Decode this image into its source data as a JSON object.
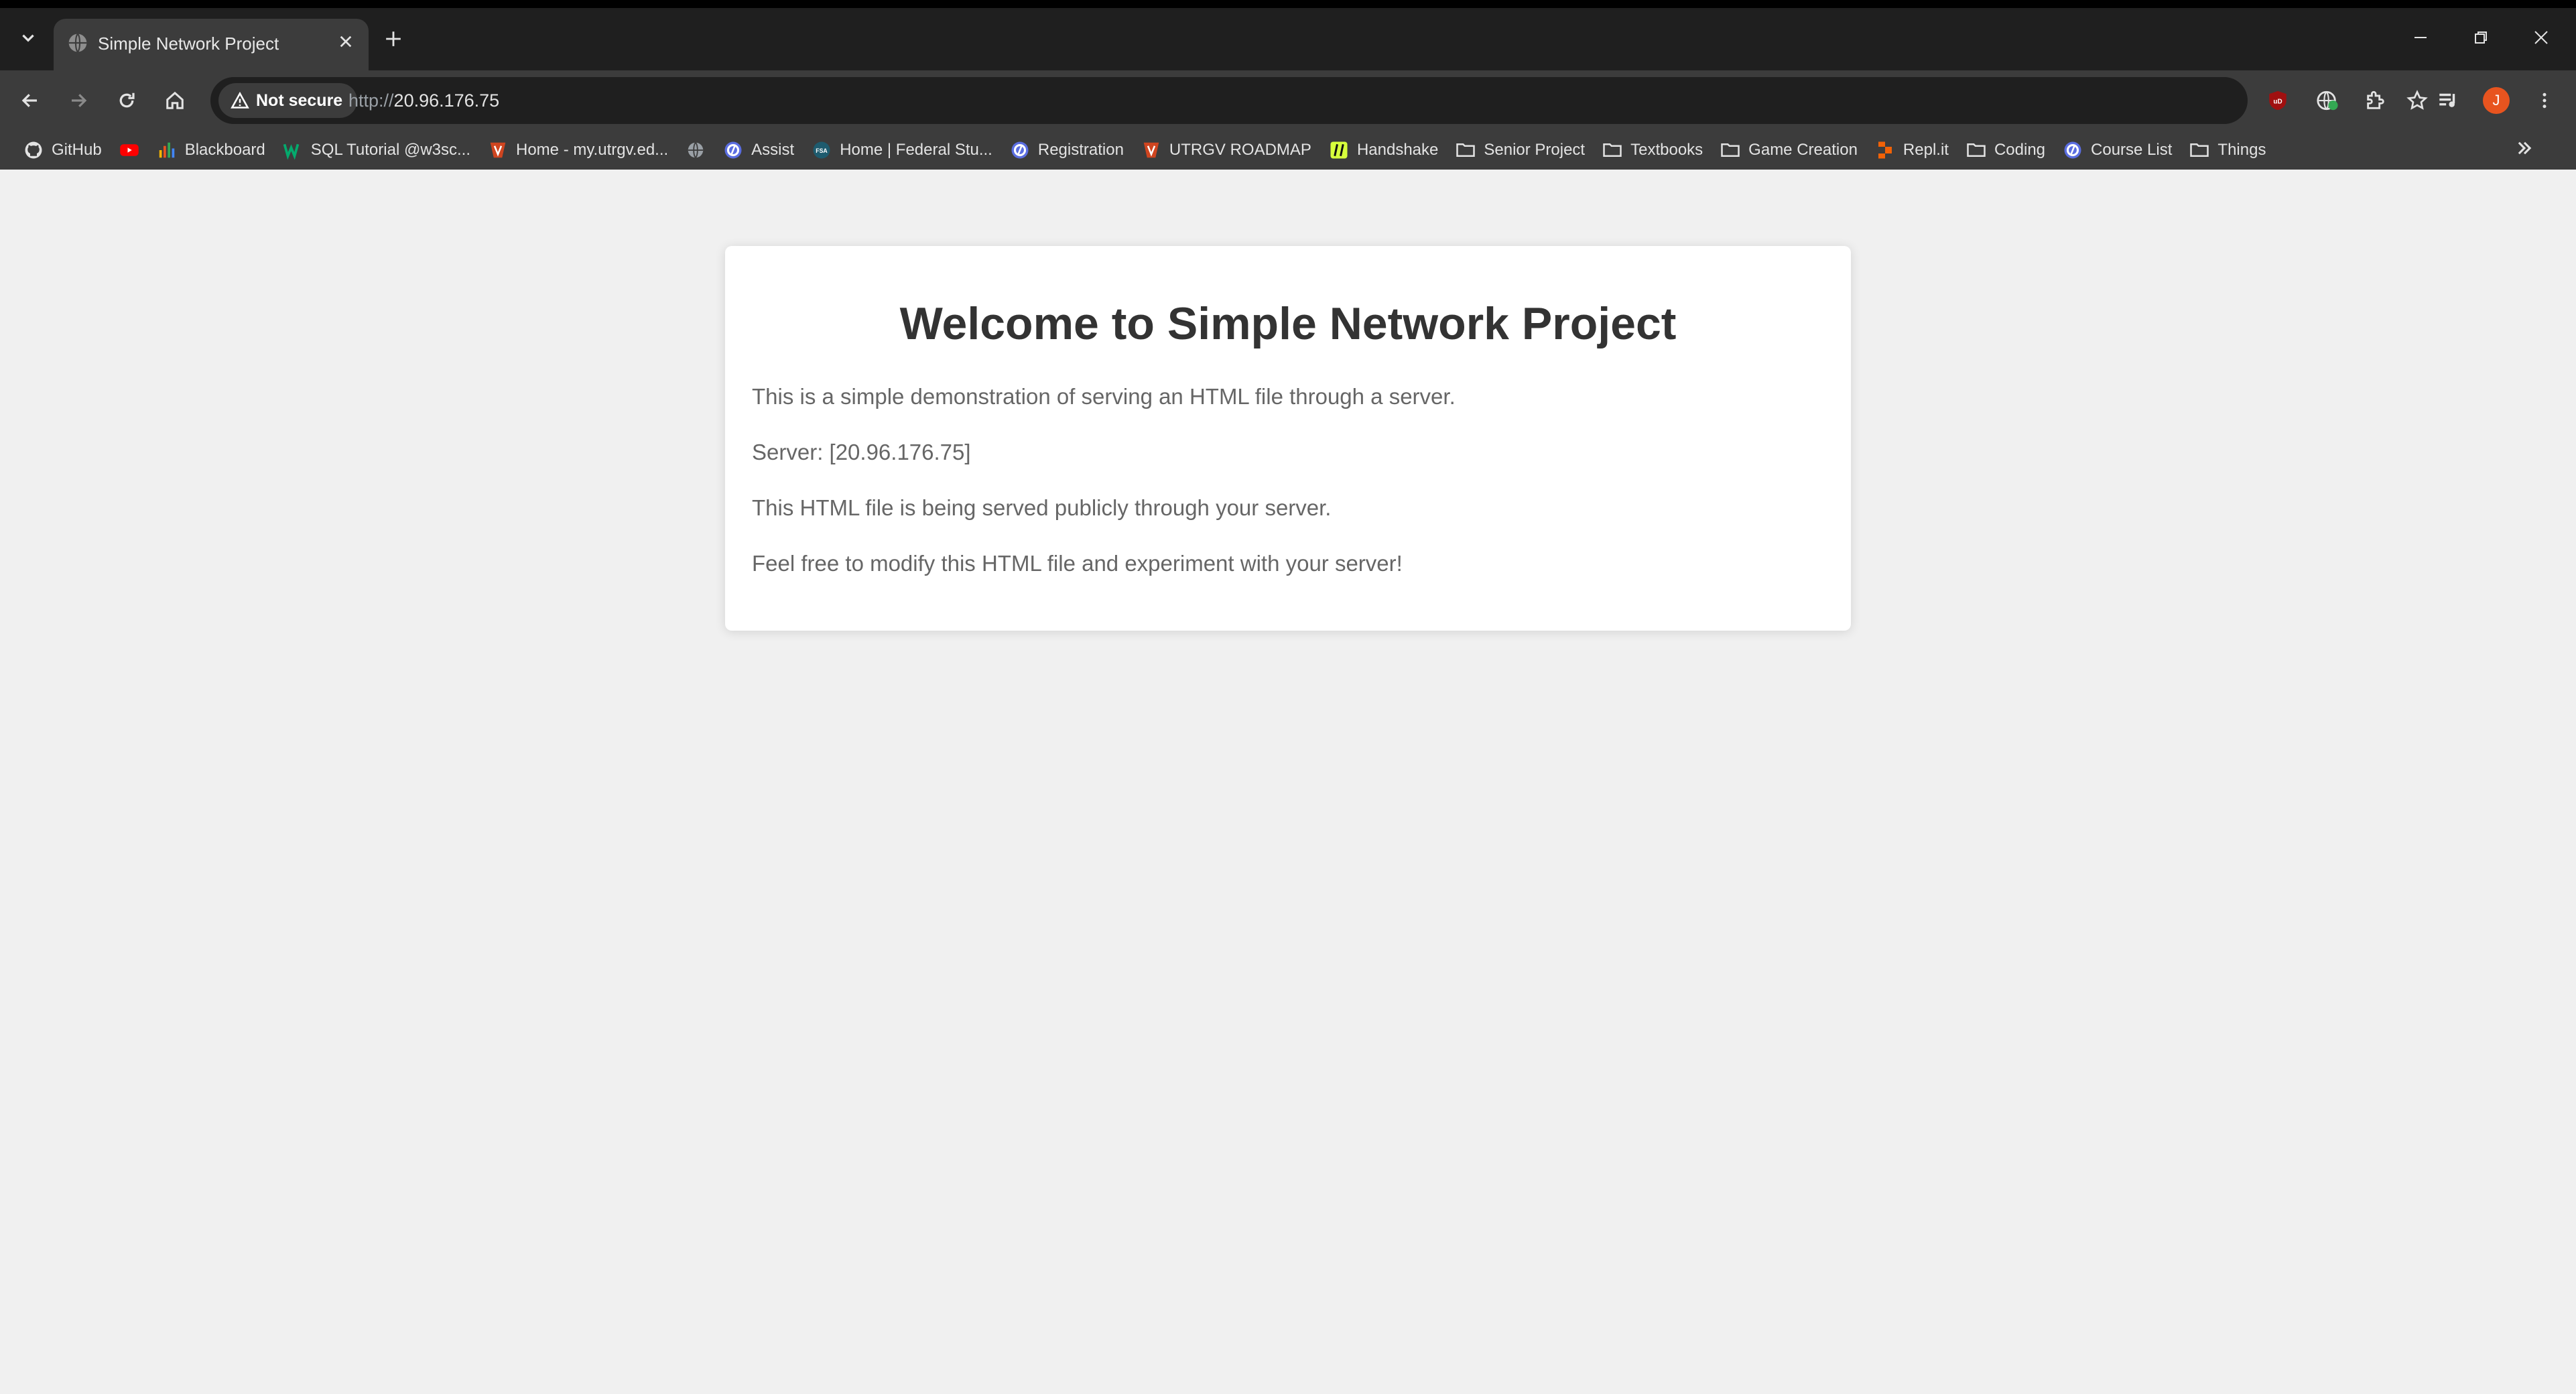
{
  "browser": {
    "tab": {
      "title": "Simple Network Project"
    },
    "address_bar": {
      "security_label": "Not secure",
      "url_scheme": "http://",
      "url_host": "20.96.176.75"
    },
    "profile_initial": "J",
    "bookmarks": [
      {
        "label": "GitHub",
        "icon": "github-icon"
      },
      {
        "label": "",
        "icon": "youtube-icon"
      },
      {
        "label": "Blackboard",
        "icon": "blackboard-icon"
      },
      {
        "label": "SQL Tutorial @w3sc...",
        "icon": "w3schools-icon"
      },
      {
        "label": "Home - my.utrgv.ed...",
        "icon": "utrgv-icon"
      },
      {
        "label": "",
        "icon": "globe-icon"
      },
      {
        "label": "Assist",
        "icon": "assist-icon"
      },
      {
        "label": "Home | Federal Stu...",
        "icon": "fsa-icon"
      },
      {
        "label": "Registration",
        "icon": "assist-icon"
      },
      {
        "label": "UTRGV ROADMAP",
        "icon": "utrgv-icon"
      },
      {
        "label": "Handshake",
        "icon": "handshake-icon"
      },
      {
        "label": "Senior Project",
        "icon": "folder-icon"
      },
      {
        "label": "Textbooks",
        "icon": "folder-icon"
      },
      {
        "label": "Game Creation",
        "icon": "folder-icon"
      },
      {
        "label": "Repl.it",
        "icon": "replit-icon"
      },
      {
        "label": "Coding",
        "icon": "folder-icon"
      },
      {
        "label": "Course List",
        "icon": "assist-icon"
      },
      {
        "label": "Things",
        "icon": "folder-icon"
      }
    ]
  },
  "page": {
    "heading": "Welcome to Simple Network Project",
    "paragraphs": [
      "This is a simple demonstration of serving an HTML file through a server.",
      "Server: [20.96.176.75]",
      "This HTML file is being served publicly through your server.",
      "Feel free to modify this HTML file and experiment with your server!"
    ]
  },
  "colors": {
    "tabstrip": "#1f1f1f",
    "toolbar": "#3c3c3c",
    "page_background": "#f0f0f0",
    "card": "#ffffff",
    "heading_text": "#333333",
    "body_text": "#666666",
    "profile_avatar": "#e8541f"
  }
}
